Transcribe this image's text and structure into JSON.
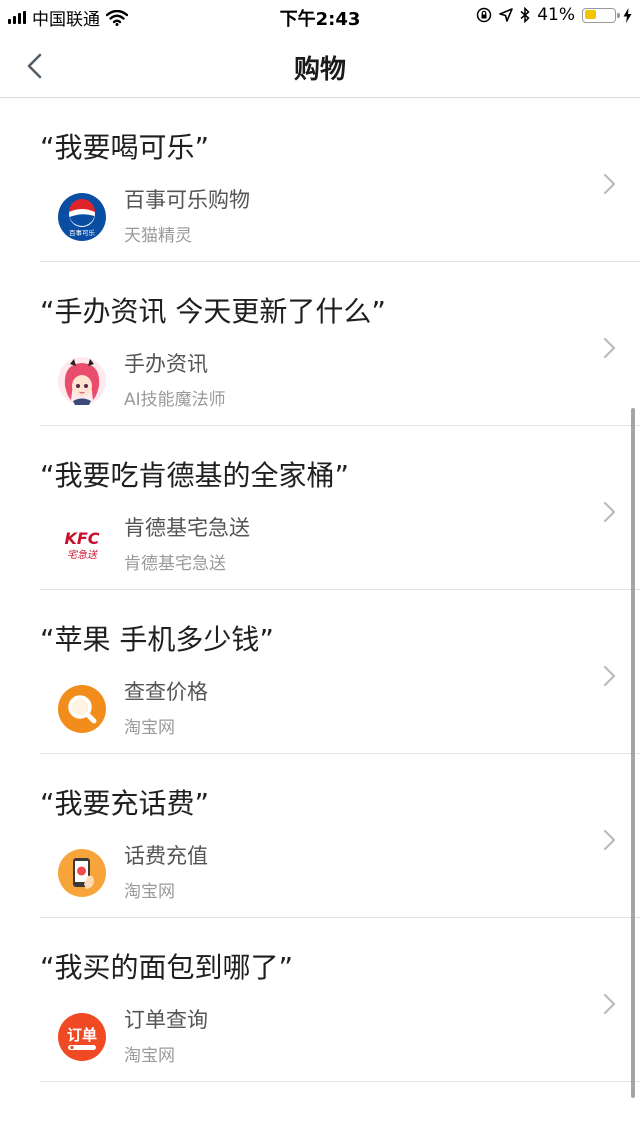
{
  "status_bar": {
    "carrier": "中国联通",
    "time": "下午2:43",
    "battery_percent": "41%",
    "battery_level": 0.41,
    "icons": [
      "signal-icon",
      "wifi-icon",
      "orientation-lock-icon",
      "location-icon",
      "bluetooth-icon",
      "battery-icon",
      "charging-icon"
    ]
  },
  "nav": {
    "title": "购物",
    "back_icon": "chevron-left-icon"
  },
  "items": [
    {
      "phrase": "“我要喝可乐”",
      "skill": "百事可乐购物",
      "provider": "天猫精灵",
      "icon": "pepsi-logo-icon",
      "icon_text": "百事可乐"
    },
    {
      "phrase": "“手办资讯 今天更新了什么”",
      "skill": "手办资讯",
      "provider": "AI技能魔法师",
      "icon": "anime-figure-avatar-icon"
    },
    {
      "phrase": "“我要吃肯德基的全家桶”",
      "skill": "肯德基宅急送",
      "provider": "肯德基宅急送",
      "icon": "kfc-logo-icon",
      "icon_text": "KFC",
      "icon_subtext": "宅急送"
    },
    {
      "phrase": "“苹果 手机多少钱”",
      "skill": "查查价格",
      "provider": "淘宝网",
      "icon": "magnifier-icon"
    },
    {
      "phrase": "“我要充话费”",
      "skill": "话费充值",
      "provider": "淘宝网",
      "icon": "phone-recharge-icon"
    },
    {
      "phrase": "“我买的面包到哪了”",
      "skill": "订单查询",
      "provider": "淘宝网",
      "icon": "order-query-icon",
      "icon_text": "订单"
    }
  ],
  "colors": {
    "pepsi_blue": "#0a4ea3",
    "pepsi_red": "#e1232b",
    "kfc_red": "#c8102e",
    "search_orange": "#f28c1a",
    "recharge_orange": "#f7a43a",
    "order_red": "#f04a24",
    "battery_yellow": "#f5c400"
  }
}
